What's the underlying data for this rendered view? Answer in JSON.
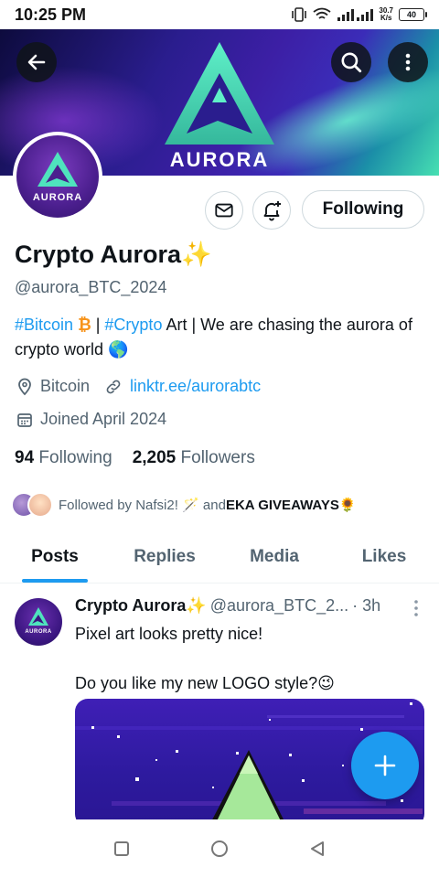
{
  "status_bar": {
    "time": "10:25 PM",
    "speed_value": "30.7",
    "speed_unit": "K/s",
    "battery": "40"
  },
  "banner": {
    "wordmark": "AURORA"
  },
  "avatar": {
    "wordmark": "AURORA"
  },
  "profile": {
    "name": "Crypto Aurora✨",
    "handle": "@aurora_BTC_2024",
    "bio": {
      "tag1": "#Bitcoin",
      "tag1_emoji": "₿",
      "sep1": " | ",
      "tag2": "#Crypto",
      "rest": " Art | We are chasing the aurora of crypto world 🌎"
    },
    "location": "Bitcoin",
    "website": "linktr.ee/aurorabtc",
    "joined": "Joined April 2024",
    "following_count": "94",
    "following_label": "Following",
    "followers_count": "2,205",
    "followers_label": "Followers",
    "followed_by_prefix": "Followed by Nafsi2! 🪄 and ",
    "followed_by_bold": "EKA GIVEAWAYS🌻",
    "follow_button": "Following"
  },
  "tabs": [
    {
      "label": "Posts",
      "active": true
    },
    {
      "label": "Replies",
      "active": false
    },
    {
      "label": "Media",
      "active": false
    },
    {
      "label": "Likes",
      "active": false
    }
  ],
  "post": {
    "name": "Crypto Aurora✨",
    "handle": "@aurora_BTC_2...",
    "time": "· 3h",
    "line1": "Pixel art looks pretty nice!",
    "line2": "Do you like my new LOGO style?😉",
    "avatar_word": "AURORA"
  },
  "colors": {
    "accent": "#1d9bf0",
    "text": "#0f1419",
    "muted": "#536471"
  }
}
